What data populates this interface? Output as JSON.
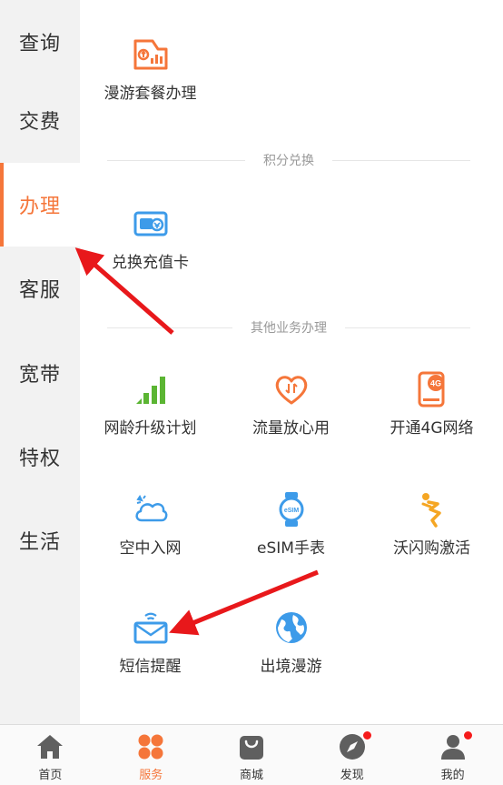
{
  "sidebar": {
    "items": [
      {
        "label": "查询"
      },
      {
        "label": "交费"
      },
      {
        "label": "办理",
        "active": true
      },
      {
        "label": "客服"
      },
      {
        "label": "宽带"
      },
      {
        "label": "特权"
      },
      {
        "label": "生活"
      }
    ]
  },
  "sections": {
    "roaming": {
      "items": [
        {
          "label": "漫游套餐办理",
          "icon": "roaming-package-icon"
        }
      ]
    },
    "points": {
      "title": "积分兑换",
      "items": [
        {
          "label": "兑换充值卡",
          "icon": "recharge-card-icon"
        }
      ]
    },
    "other": {
      "title": "其他业务办理",
      "items": [
        {
          "label": "网龄升级计划",
          "icon": "signal-bars-icon"
        },
        {
          "label": "流量放心用",
          "icon": "data-heart-icon"
        },
        {
          "label": "开通4G网络",
          "icon": "4g-phone-icon"
        },
        {
          "label": "空中入网",
          "icon": "cloud-network-icon"
        },
        {
          "label": "eSIM手表",
          "icon": "esim-watch-icon"
        },
        {
          "label": "沃闪购激活",
          "icon": "flash-buy-icon"
        },
        {
          "label": "短信提醒",
          "icon": "sms-envelope-icon"
        },
        {
          "label": "出境漫游",
          "icon": "globe-icon"
        }
      ]
    }
  },
  "tabbar": {
    "items": [
      {
        "label": "首页",
        "icon": "home-icon"
      },
      {
        "label": "服务",
        "icon": "service-grid-icon",
        "active": true
      },
      {
        "label": "商城",
        "icon": "shopping-bag-icon"
      },
      {
        "label": "发现",
        "icon": "compass-icon",
        "badge": true
      },
      {
        "label": "我的",
        "icon": "user-icon",
        "badge": true
      }
    ]
  },
  "colors": {
    "accent": "#f5763a",
    "badge": "#f51b1b",
    "annotation_arrow": "#e8181b",
    "blue_icon": "#3d9be9",
    "green_icon": "#5bb533"
  }
}
